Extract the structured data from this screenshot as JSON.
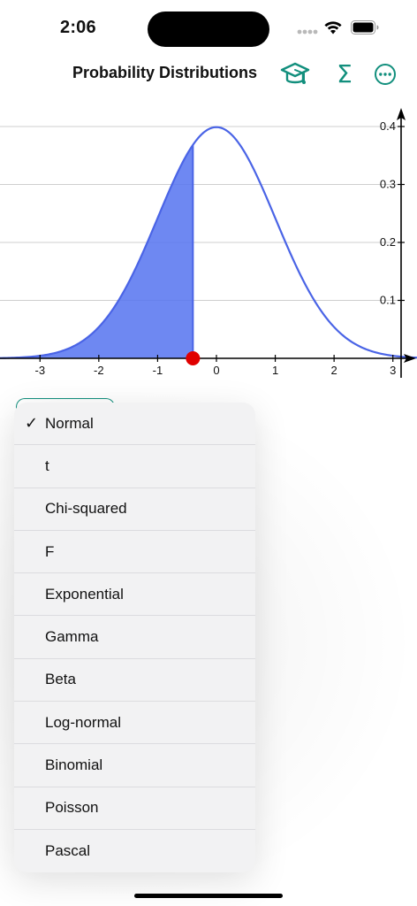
{
  "status": {
    "time": "2:06"
  },
  "nav": {
    "title": "Probability Distributions",
    "icons": [
      "graduation-cap-icon",
      "sigma-icon",
      "ellipsis-circle-icon"
    ],
    "sigma_glyph": "Σ",
    "accent": "#128f7d"
  },
  "chart_data": {
    "type": "area",
    "distribution": "standard normal pdf",
    "x_ticks": [
      -3,
      -2,
      -1,
      0,
      1,
      2,
      3
    ],
    "x_tick_labels": [
      "-3",
      "-2",
      "-1",
      "0",
      "1",
      "2",
      "3"
    ],
    "y_ticks": [
      0.1,
      0.2,
      0.3,
      0.4
    ],
    "y_tick_labels": [
      "0.1",
      "0.2",
      "0.3",
      "0.4"
    ],
    "xlim": [
      -3.68,
      3.41
    ],
    "ylim": [
      0,
      0.4
    ],
    "shaded_upper_bound": -0.4,
    "marker_x": -0.4,
    "curve_color": "#4a64e6",
    "fill_color": "#5a78f0",
    "marker_color": "#e00000",
    "grid": true
  },
  "menu": {
    "selected_check": "✓",
    "items": [
      {
        "label": "Normal",
        "selected": true
      },
      {
        "label": "t",
        "selected": false
      },
      {
        "label": "Chi-squared",
        "selected": false
      },
      {
        "label": "F",
        "selected": false
      },
      {
        "label": "Exponential",
        "selected": false
      },
      {
        "label": "Gamma",
        "selected": false
      },
      {
        "label": "Beta",
        "selected": false
      },
      {
        "label": "Log-normal",
        "selected": false
      },
      {
        "label": "Binomial",
        "selected": false
      },
      {
        "label": "Poisson",
        "selected": false
      },
      {
        "label": "Pascal",
        "selected": false
      }
    ]
  }
}
